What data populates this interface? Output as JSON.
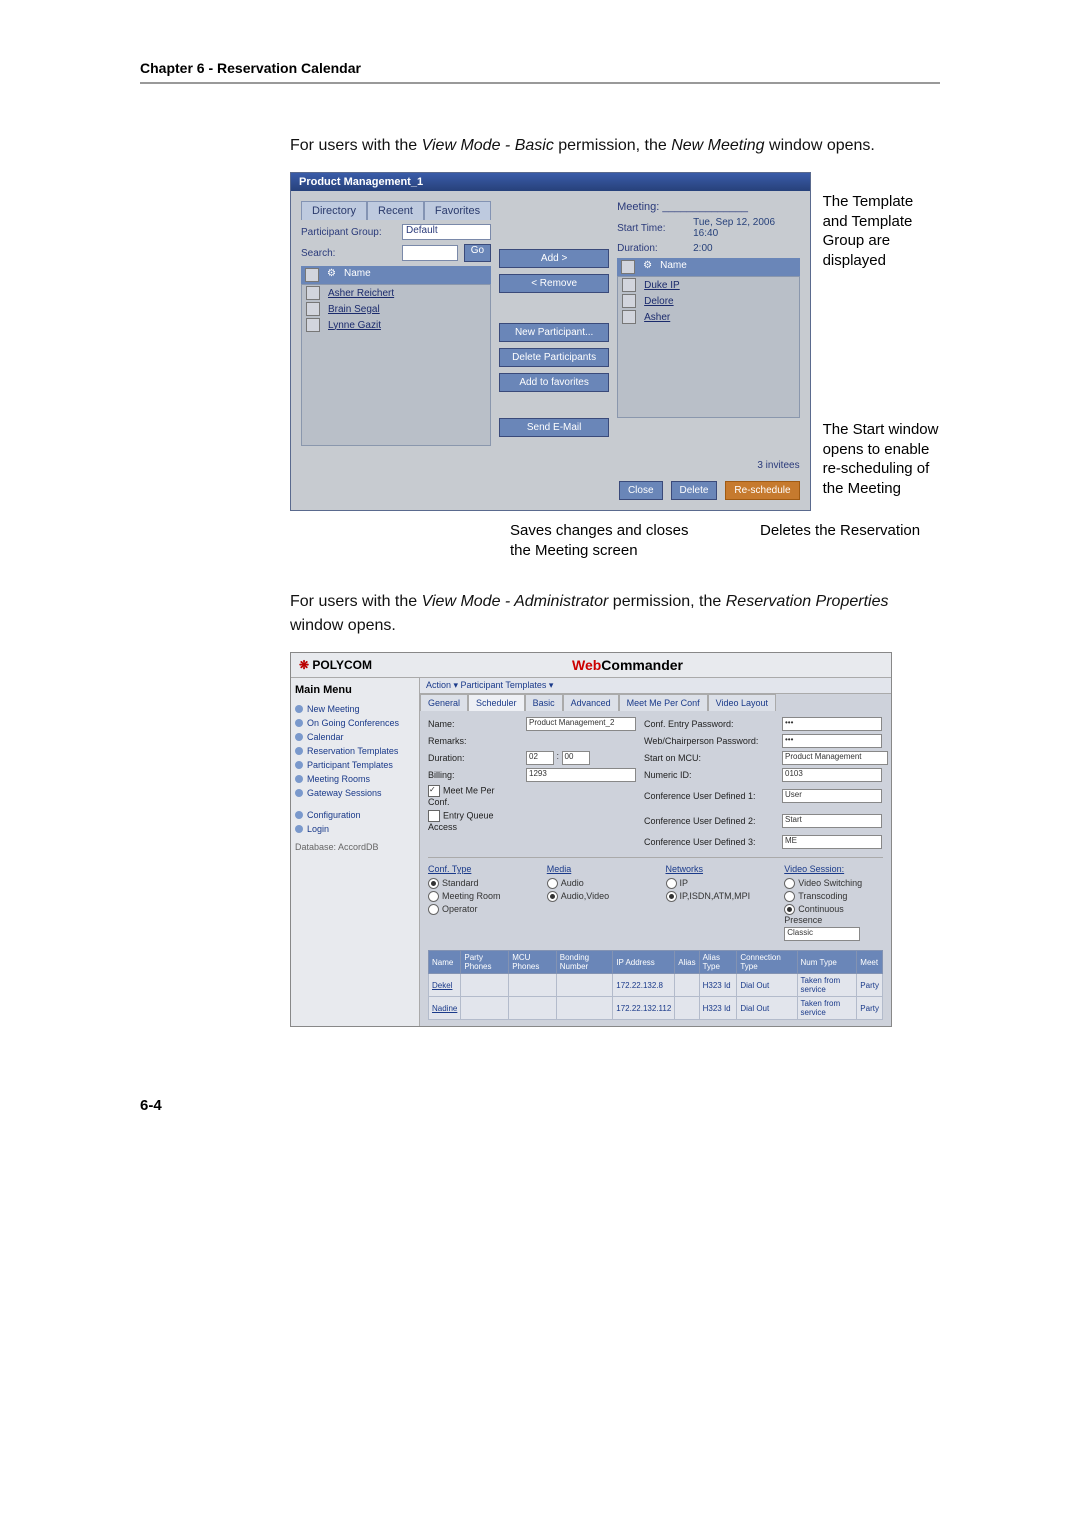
{
  "chapter": "Chapter 6 - Reservation Calendar",
  "intro1_a": "For users with the ",
  "intro1_b": "View Mode - Basic",
  "intro1_c": " permission, the ",
  "intro1_d": "New Meeting",
  "intro1_e": " window opens.",
  "fig1": {
    "title": "Product Management_1",
    "tabs": {
      "directory": "Directory",
      "recent": "Recent",
      "favorites": "Favorites"
    },
    "pgroup_lbl": "Participant Group:",
    "pgroup_val": "Default",
    "search_lbl": "Search:",
    "go": "Go",
    "name_hdr": "Name",
    "left_list": {
      "r1": "Asher Reichert",
      "r2": "Brain Segal",
      "r3": "Lynne Gazit"
    },
    "center": {
      "add": "Add >",
      "remove": "< Remove",
      "newp": "New Participant...",
      "delp": "Delete Participants",
      "addfav": "Add to favorites",
      "send": "Send E-Mail"
    },
    "meeting_hdr": "Meeting: ______________",
    "start_lbl": "Start Time:",
    "start_val": "Tue, Sep 12, 2006   16:40",
    "dur_lbl": "Duration:",
    "dur_val": "2:00",
    "right_list": {
      "r1": "Duke IP",
      "r2": "Delore",
      "r3": "Asher"
    },
    "invitees": "3 invitees",
    "close": "Close",
    "delete": "Delete",
    "resched": "Re-schedule"
  },
  "annot": {
    "right1": "The Template and Template Group are displayed",
    "right2": "The Start window opens to enable re-scheduling of the Meeting",
    "low1": "Saves changes and closes the Meeting screen",
    "low2": "Deletes the Reservation"
  },
  "intro2_a": "For users with the ",
  "intro2_b": "View Mode - Administrator",
  "intro2_c": " permission, the ",
  "intro2_d": "Reservation Properties",
  "intro2_e": " window opens.",
  "fig2": {
    "logo_pre": "POLYCOM",
    "title_web": "Web",
    "title_cmd": "Commander",
    "mainmenu": "Main Menu",
    "nav": {
      "newmeeting": "New Meeting",
      "ongoing": "On Going Conferences",
      "calendar": "Calendar",
      "restempl": "Reservation Templates",
      "parttempl": "Participant Templates",
      "meetingrooms": "Meeting Rooms",
      "gateway": "Gateway Sessions",
      "config": "Configuration",
      "login": "Login"
    },
    "db": "Database: AccordDB",
    "menubar": "Action ▾   Participant Templates ▾",
    "tabs": {
      "general": "General",
      "scheduler": "Scheduler",
      "basic": "Basic",
      "advanced": "Advanced",
      "meetme": "Meet Me Per Conf",
      "video": "Video Layout"
    },
    "form": {
      "name_lbl": "Name:",
      "name_val": "Product Management_2",
      "remarks_lbl": "Remarks:",
      "duration_lbl": "Duration:",
      "duration_h": "02",
      "duration_m": "00",
      "billing_lbl": "Billing:",
      "billing_val": "1293",
      "meetme_lbl": "Meet Me Per Conf.",
      "eq_lbl": "Entry Queue Access",
      "cep_lbl": "Conf. Entry Password:",
      "cep_val": "•••",
      "wcp_lbl": "Web/Chairperson Password:",
      "wcp_val": "•••",
      "startmcu_lbl": "Start on MCU:",
      "startmcu_val": "Product Management",
      "numid_lbl": "Numeric ID:",
      "numid_val": "0103",
      "ud1_lbl": "Conference User Defined 1:",
      "ud1_val": "User",
      "ud2_lbl": "Conference User Defined 2:",
      "ud2_val": "Start",
      "ud3_lbl": "Conference User Defined 3:",
      "ud3_val": "ME"
    },
    "sections": {
      "conftype": "Conf. Type",
      "ct_standard": "Standard",
      "ct_meetingroom": "Meeting Room",
      "ct_operator": "Operator",
      "media": "Media",
      "m_audio": "Audio",
      "m_av": "Audio,Video",
      "networks": "Networks",
      "n_ip": "IP",
      "n_mix": "IP,ISDN,ATM,MPI",
      "video": "Video Session:",
      "v_sw": "Video Switching",
      "v_tr": "Transcoding",
      "v_cp": "Continuous Presence",
      "v_cp_sel": "Classic"
    },
    "table": {
      "h_name": "Name",
      "h_pp": "Party Phones",
      "h_mcu": "MCU Phones",
      "h_bond": "Bonding Number",
      "h_ip": "IP Address",
      "h_alias": "Alias",
      "h_aliastype": "Alias Type",
      "h_conn": "Connection Type",
      "h_num": "Num Type",
      "h_meet": "Meet",
      "r1_name": "Dekel",
      "r1_ip": "172.22.132.8",
      "r1_at": "H323 Id",
      "r1_ct": "Dial Out",
      "r1_nt": "Taken from service",
      "r1_mt": "Party",
      "r2_name": "Nadine",
      "r2_ip": "172.22.132.112",
      "r2_at": "H323 Id",
      "r2_ct": "Dial Out",
      "r2_nt": "Taken from service",
      "r2_mt": "Party"
    }
  },
  "pagenum": "6-4"
}
